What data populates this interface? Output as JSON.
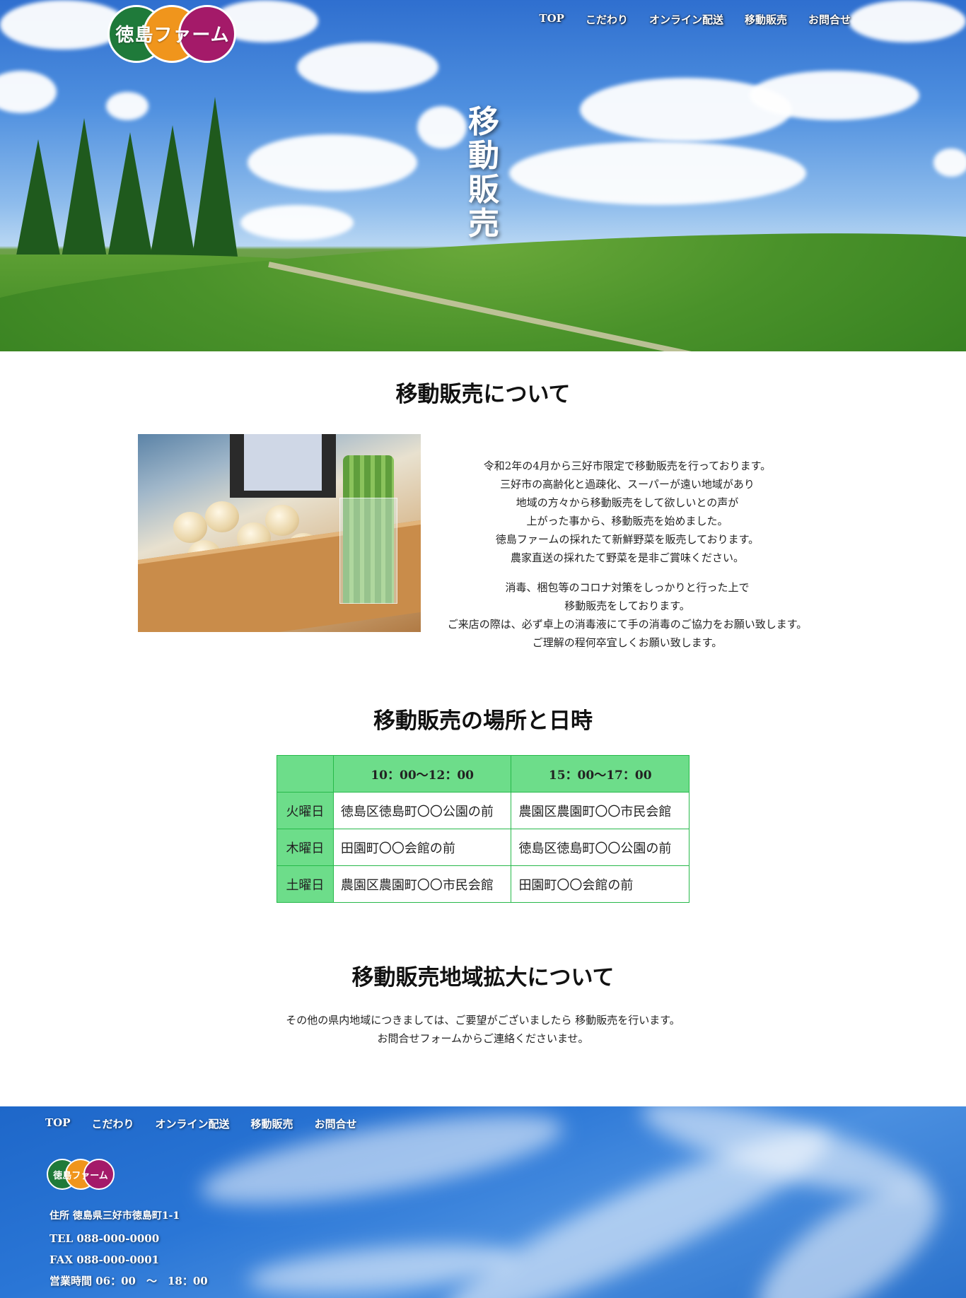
{
  "brand": {
    "logo_text": "徳島ファーム"
  },
  "nav": [
    {
      "label": "TOP"
    },
    {
      "label": "こだわり"
    },
    {
      "label": "オンライン配送"
    },
    {
      "label": "移動販売"
    },
    {
      "label": "お問合せ"
    }
  ],
  "hero": {
    "title_chars": [
      "移",
      "動",
      "販",
      "売"
    ]
  },
  "about": {
    "heading": "移動販売について",
    "para1": [
      "令和2年の4月から三好市限定で移動販売を行っております。",
      "三好市の高齢化と過疎化、スーパーが遠い地域があり",
      "地域の方々から移動販売をして欲しいとの声が",
      "上がった事から、移動販売を始めました。",
      "徳島ファームの採れたて新鮮野菜を販売しております。",
      "農家直送の採れたて野菜を是非ご賞味ください。"
    ],
    "para2": [
      "消毒、梱包等のコロナ対策をしっかりと行った上で",
      "移動販売をしております。",
      "ご来店の際は、必ず卓上の消毒液にて手の消毒のご協力をお願い致します。",
      "ご理解の程何卒宜しくお願い致します。"
    ]
  },
  "schedule": {
    "heading": "移動販売の場所と日時",
    "columns": [
      "",
      "10：00～12：00",
      "15：00～17：00"
    ],
    "rows": [
      {
        "day": "火曜日",
        "am": "徳島区徳島町〇〇公園の前",
        "pm": "農園区農園町〇〇市民会館"
      },
      {
        "day": "木曜日",
        "am": "田園町〇〇会館の前",
        "pm": "徳島区徳島町〇〇公園の前"
      },
      {
        "day": "土曜日",
        "am": "農園区農園町〇〇市民会館",
        "pm": "田園町〇〇会館の前"
      }
    ]
  },
  "expand": {
    "heading": "移動販売地域拡大について",
    "lines": [
      "その他の県内地域につきましては、ご要望がございましたら 移動販売を行います。",
      "お問合せフォームからご連絡くださいませ。"
    ]
  },
  "footer": {
    "logo_text": "徳島ファーム",
    "address": "住所 徳島県三好市徳島町1-1",
    "tel": "TEL 088-000-0000",
    "fax": "FAX 088-000-0001",
    "hours": "営業時間 06：00　～　18：00"
  },
  "colors": {
    "table_header": "#6ddd8a",
    "table_border": "#27b94a",
    "logo_green": "#1f7a3a",
    "logo_orange": "#f0951c",
    "logo_magenta": "#a41a69"
  }
}
